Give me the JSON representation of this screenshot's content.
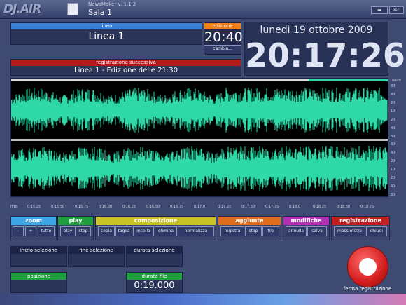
{
  "app": {
    "logo": "DJ.AIR",
    "name": "NewsMaker v. 1.1.2",
    "room": "Sala  1",
    "minimize_label": "",
    "close_label": "esci"
  },
  "colors": {
    "linea": "#3a7fd6",
    "edizione": "#f0801c",
    "registrazione": "#b51a1a",
    "wave": "#2ed8a7"
  },
  "linea": {
    "header": "linea",
    "value": "Linea 1"
  },
  "edizione": {
    "header": "edizione",
    "value": "20:40",
    "button": "cambia..."
  },
  "next_recording": {
    "header": "registrazione successiva",
    "value": "Linea 1 - Edizione delle 21:30"
  },
  "clock": {
    "date": "lunedì 19 ottobre 2009",
    "time": "20:17:26"
  },
  "waveform": {
    "norm_label": "norm",
    "db_labels": [
      "80",
      "40",
      "20",
      "10",
      "20",
      "40",
      "80"
    ],
    "db_labels_lower": [
      "80",
      "40",
      "20",
      "10",
      "20",
      "40",
      "80"
    ],
    "time_unit": "hms",
    "time_labels": [
      "0:15.25",
      "0:15.50",
      "0:15.75",
      "0:16.00",
      "0:16.25",
      "0:16.50",
      "0:16.75",
      "0:17.0",
      "0:17.25",
      "0:17.50",
      "0:17.75",
      "0:18.0",
      "0:18.25",
      "0:18.50",
      "0:18.75"
    ]
  },
  "groups": {
    "zoom": {
      "label": "zoom",
      "color": "#3da7e6",
      "buttons": [
        "-",
        "+",
        "tutto"
      ]
    },
    "play": {
      "label": "play",
      "color": "#1e9e3c",
      "buttons": [
        "play",
        "stop"
      ]
    },
    "composizione": {
      "label": "composizione",
      "color": "#c9c226",
      "buttons": [
        "copia",
        "taglia",
        "incolla",
        "elimina",
        "normalizza"
      ]
    },
    "aggiunte": {
      "label": "aggiunte",
      "color": "#e06c1e",
      "buttons": [
        "registra",
        "stop",
        "file"
      ]
    },
    "modifiche": {
      "label": "modifiche",
      "color": "#b12fb0",
      "buttons": [
        "annulla",
        "salva"
      ]
    },
    "registrazione": {
      "label": "registrazione",
      "color": "#c01f1f",
      "buttons": [
        "massimizza",
        "chiudi"
      ]
    }
  },
  "selection": {
    "start": "inizio selezione",
    "end": "fine selezione",
    "duration": "durata selezione"
  },
  "position": {
    "label": "posizione",
    "value": ""
  },
  "file_duration": {
    "label": "durata file",
    "value": "0:19.000"
  },
  "stop_button": {
    "label": "ferma registrazione"
  }
}
